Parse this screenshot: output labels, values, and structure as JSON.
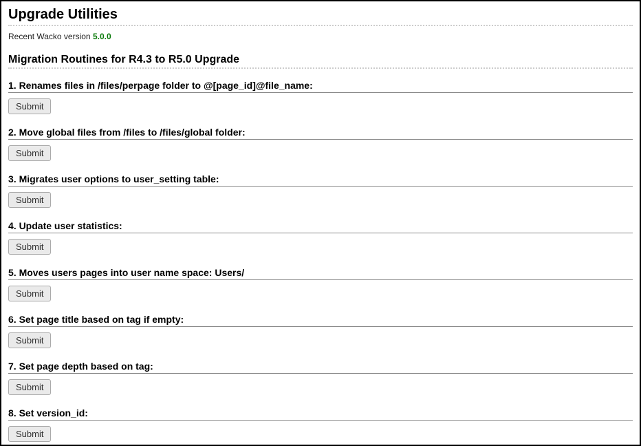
{
  "page_title": "Upgrade Utilities",
  "version_label": "Recent Wacko version ",
  "version_value": "5.0.0",
  "section_heading": "Migration Routines for R4.3 to R5.0 Upgrade",
  "submit_label": "Submit",
  "routines": [
    "1. Renames files in /files/perpage folder to @[page_id]@file_name:",
    "2. Move global files from /files to /files/global folder:",
    "3. Migrates user options to user_setting table:",
    "4. Update user statistics:",
    "5. Moves users pages into user name space: Users/",
    "6. Set page title based on tag if empty:",
    "7. Set page depth based on tag:",
    "8. Set version_id:"
  ]
}
